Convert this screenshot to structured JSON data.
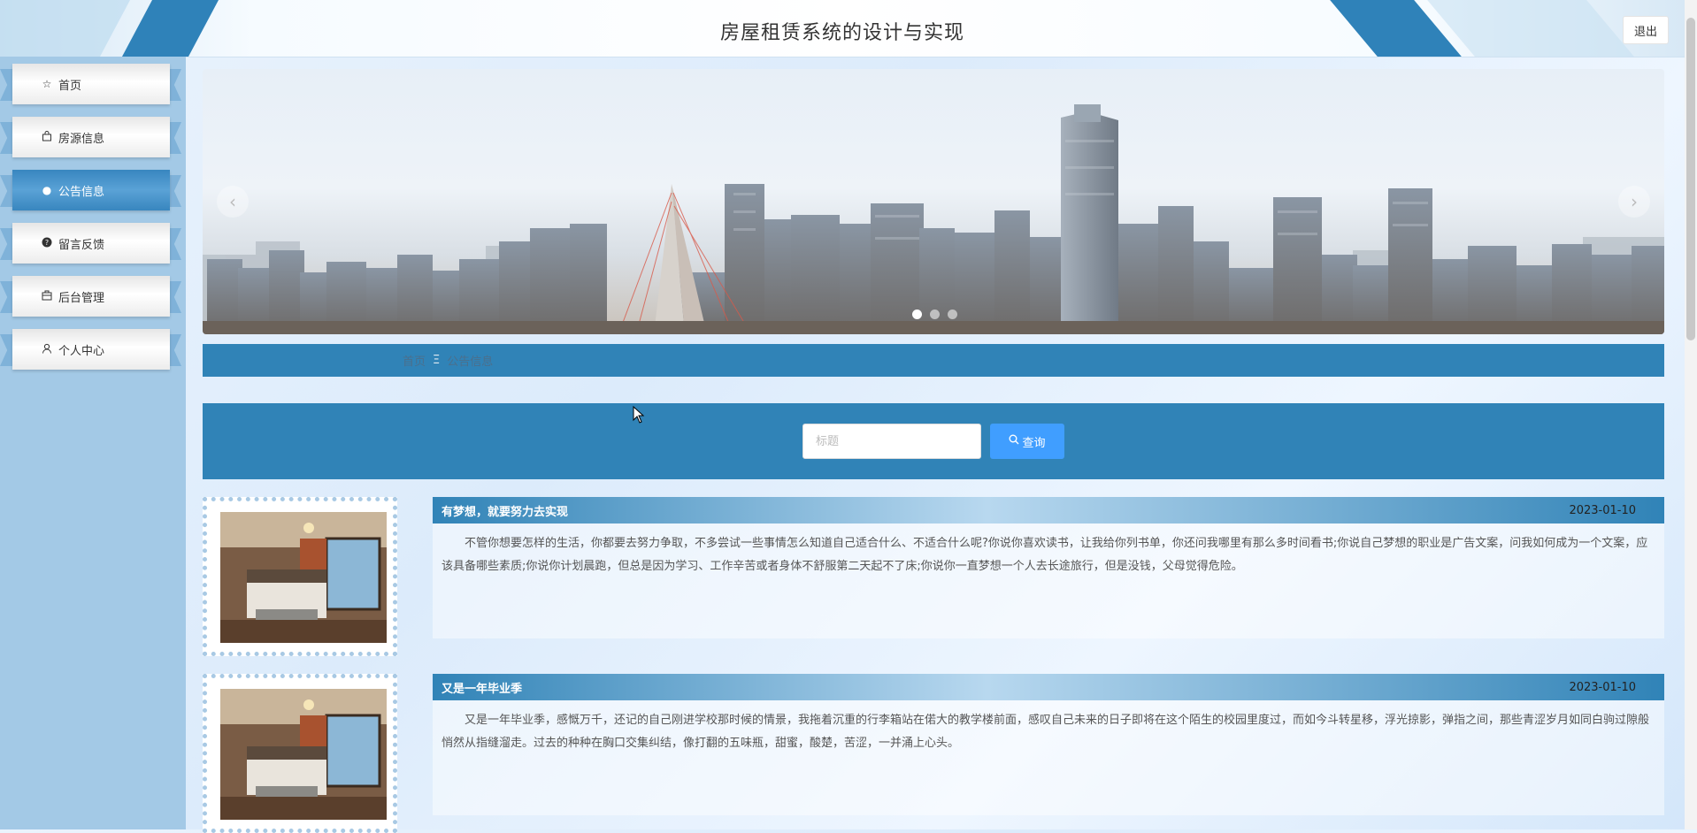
{
  "header": {
    "title": "房屋租赁系统的设计与实现",
    "logout_label": "退出"
  },
  "sidebar": {
    "items": [
      {
        "label": "首页",
        "icon": "star-icon",
        "active": false
      },
      {
        "label": "房源信息",
        "icon": "bag-icon",
        "active": false
      },
      {
        "label": "公告信息",
        "icon": "circle-icon",
        "active": true
      },
      {
        "label": "留言反馈",
        "icon": "question-circle-icon",
        "active": false
      },
      {
        "label": "后台管理",
        "icon": "box-icon",
        "active": false
      },
      {
        "label": "个人中心",
        "icon": "user-icon",
        "active": false
      }
    ]
  },
  "carousel": {
    "prev_icon": "chevron-left-icon",
    "next_icon": "chevron-right-icon",
    "slide_count": 3,
    "active_slide": 1
  },
  "breadcrumb": {
    "home": "首页",
    "separator": "Ξ",
    "current": "公告信息"
  },
  "search": {
    "placeholder": "标题",
    "value": "",
    "button_label": "查询"
  },
  "news": [
    {
      "title": "有梦想，就要努力去实现",
      "date": "2023-01-10",
      "content": "不管你想要怎样的生活，你都要去努力争取，不多尝试一些事情怎么知道自己适合什么、不适合什么呢?你说你喜欢读书，让我给你列书单，你还问我哪里有那么多时间看书;你说自己梦想的职业是广告文案，问我如何成为一个文案，应该具备哪些素质;你说你计划晨跑，但总是因为学习、工作辛苦或者身体不舒服第二天起不了床;你说你一直梦想一个人去长途旅行，但是没钱，父母觉得危险。"
    },
    {
      "title": "又是一年毕业季",
      "date": "2023-01-10",
      "content": "又是一年毕业季，感慨万千，还记的自己刚进学校那时候的情景，我拖着沉重的行李箱站在偌大的教学楼前面，感叹自己未来的日子即将在这个陌生的校园里度过，而如今斗转星移，浮光掠影，弹指之间，那些青涩岁月如同白驹过隙般悄然从指缝溜走。过去的种种在胸口交集纠结，像打翻的五味瓶，甜蜜，酸楚，苦涩，一并涌上心头。"
    }
  ],
  "colors": {
    "primary": "#3083b7",
    "sidebar_bg": "#a3c9e6",
    "button_blue": "#409eff"
  }
}
